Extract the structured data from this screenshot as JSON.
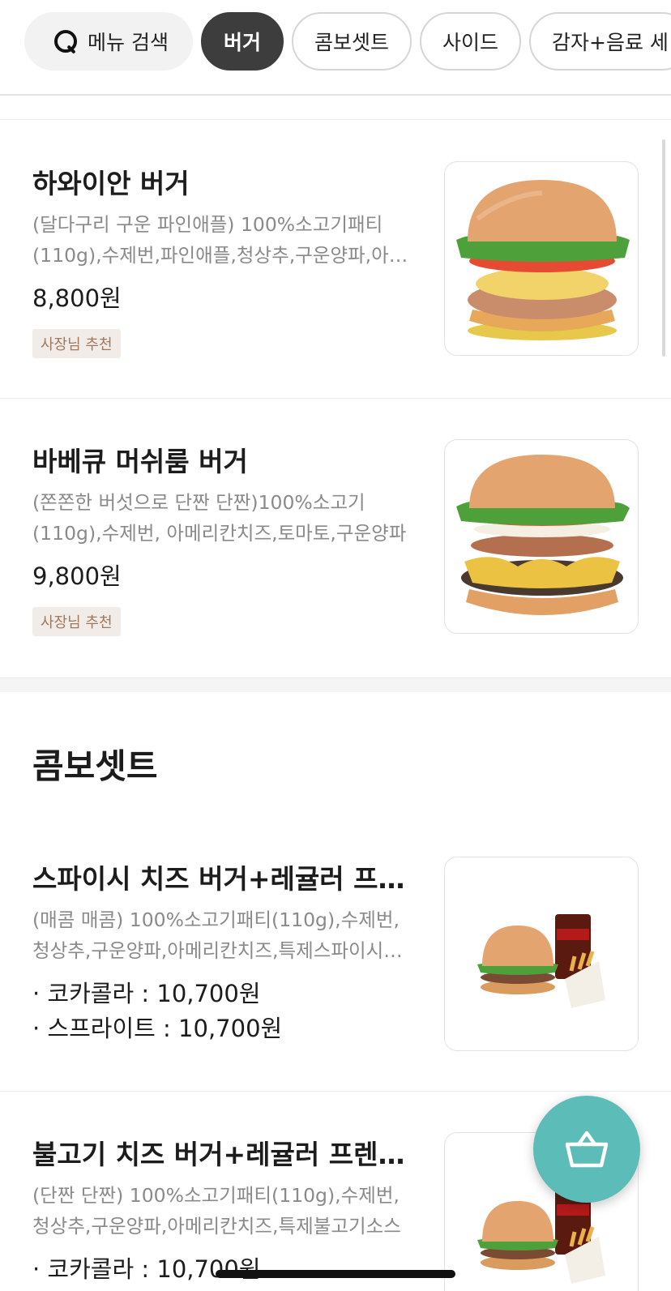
{
  "topbar": {
    "search_label": "메뉴 검색",
    "chips": [
      "버거",
      "콤보셋트",
      "사이드",
      "감자+음료 세"
    ]
  },
  "burgers": [
    {
      "name": "하와이안 버거",
      "description": "(달다구리 구운 파인애플) 100%소고기패티(110g),수제번,파인애플,청상추,구운양파,아메리칸치즈",
      "price": "8,800원",
      "badge": "사장님 추천",
      "image_icon": "hawaiian-burger-image"
    },
    {
      "name": "바베큐 머쉬룸 버거",
      "description": "(쫀쫀한 버섯으로 단짠 단짠)100%소고기(110g),수제번, 아메리칸치즈,토마토,구운양파",
      "price": "9,800원",
      "badge": "사장님 추천",
      "image_icon": "bbq-mushroom-burger-image"
    }
  ],
  "combo_section": {
    "title": "콤보셋트",
    "items": [
      {
        "name": "스파이시 치즈 버거+레귤러 프렌치프라이",
        "description": "(매콤 매콤) 100%소고기패티(110g),수제번,청상추,구운양파,아메리칸치즈,특제스파이시소스",
        "options": [
          "· 코카콜라 : 10,700원",
          "· 스프라이트 : 10,700원"
        ],
        "image_icon": "spicy-combo-image"
      },
      {
        "name": "불고기 치즈 버거+레귤러 프렌치프라이",
        "description": "(단짠 단짠) 100%소고기패티(110g),수제번,청상추,구운양파,아메리칸치즈,특제불고기소스",
        "options": [
          "· 코카콜라 : 10,700원"
        ],
        "image_icon": "bulgogi-combo-image"
      }
    ]
  },
  "cart": {
    "icon": "basket-icon"
  },
  "colors": {
    "accent": "#5cbcb7",
    "active_chip": "#3d3d3d",
    "badge_bg": "#f2ece8",
    "badge_text": "#a0785a"
  }
}
